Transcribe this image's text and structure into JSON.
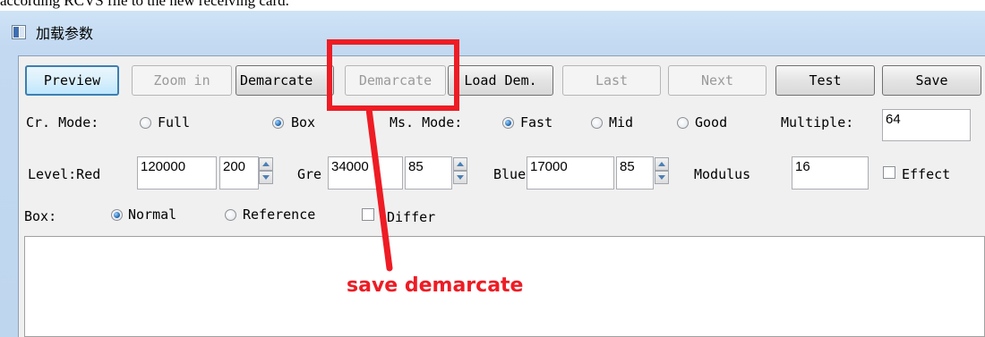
{
  "background_text": "according RCVS file to the new receiving card.",
  "window": {
    "title": "加载参数"
  },
  "toolbar": {
    "buttons": [
      {
        "label": "Preview",
        "state": "active"
      },
      {
        "label": "Zoom in",
        "state": "disabled"
      },
      {
        "label": "Demarcate",
        "state": "enabled"
      },
      {
        "label": "Demarcate",
        "state": "disabled"
      },
      {
        "label": "Load Dem.",
        "state": "enabled"
      },
      {
        "label": "Last",
        "state": "disabled"
      },
      {
        "label": "Next",
        "state": "disabled"
      },
      {
        "label": "Test",
        "state": "enabled"
      },
      {
        "label": "Save",
        "state": "enabled"
      }
    ]
  },
  "cr_mode": {
    "label": "Cr. Mode:",
    "options": [
      {
        "label": "Full",
        "checked": false
      },
      {
        "label": "Box",
        "checked": true
      }
    ]
  },
  "ms_mode": {
    "label": "Ms. Mode:",
    "options": [
      {
        "label": "Fast",
        "checked": true
      },
      {
        "label": "Mid",
        "checked": false
      },
      {
        "label": "Good",
        "checked": false
      }
    ]
  },
  "multiple": {
    "label": "Multiple:",
    "value": "64"
  },
  "level": {
    "label": "Level:Red",
    "red_value": "120000",
    "red_gain": "200",
    "green_label": "Gre",
    "green_value": "34000",
    "green_gain": "85",
    "blue_label": "Blue",
    "blue_value": "17000",
    "blue_gain": "85",
    "modulus_label": "Modulus",
    "modulus_value": "16",
    "effect_label": "Effect"
  },
  "box": {
    "label": "Box:",
    "options": [
      {
        "label": "Normal",
        "checked": true
      },
      {
        "label": "Reference",
        "checked": false
      }
    ],
    "differ_label": "Differ"
  },
  "annotation": {
    "text": "save demarcate",
    "color": "#ee1c24"
  }
}
